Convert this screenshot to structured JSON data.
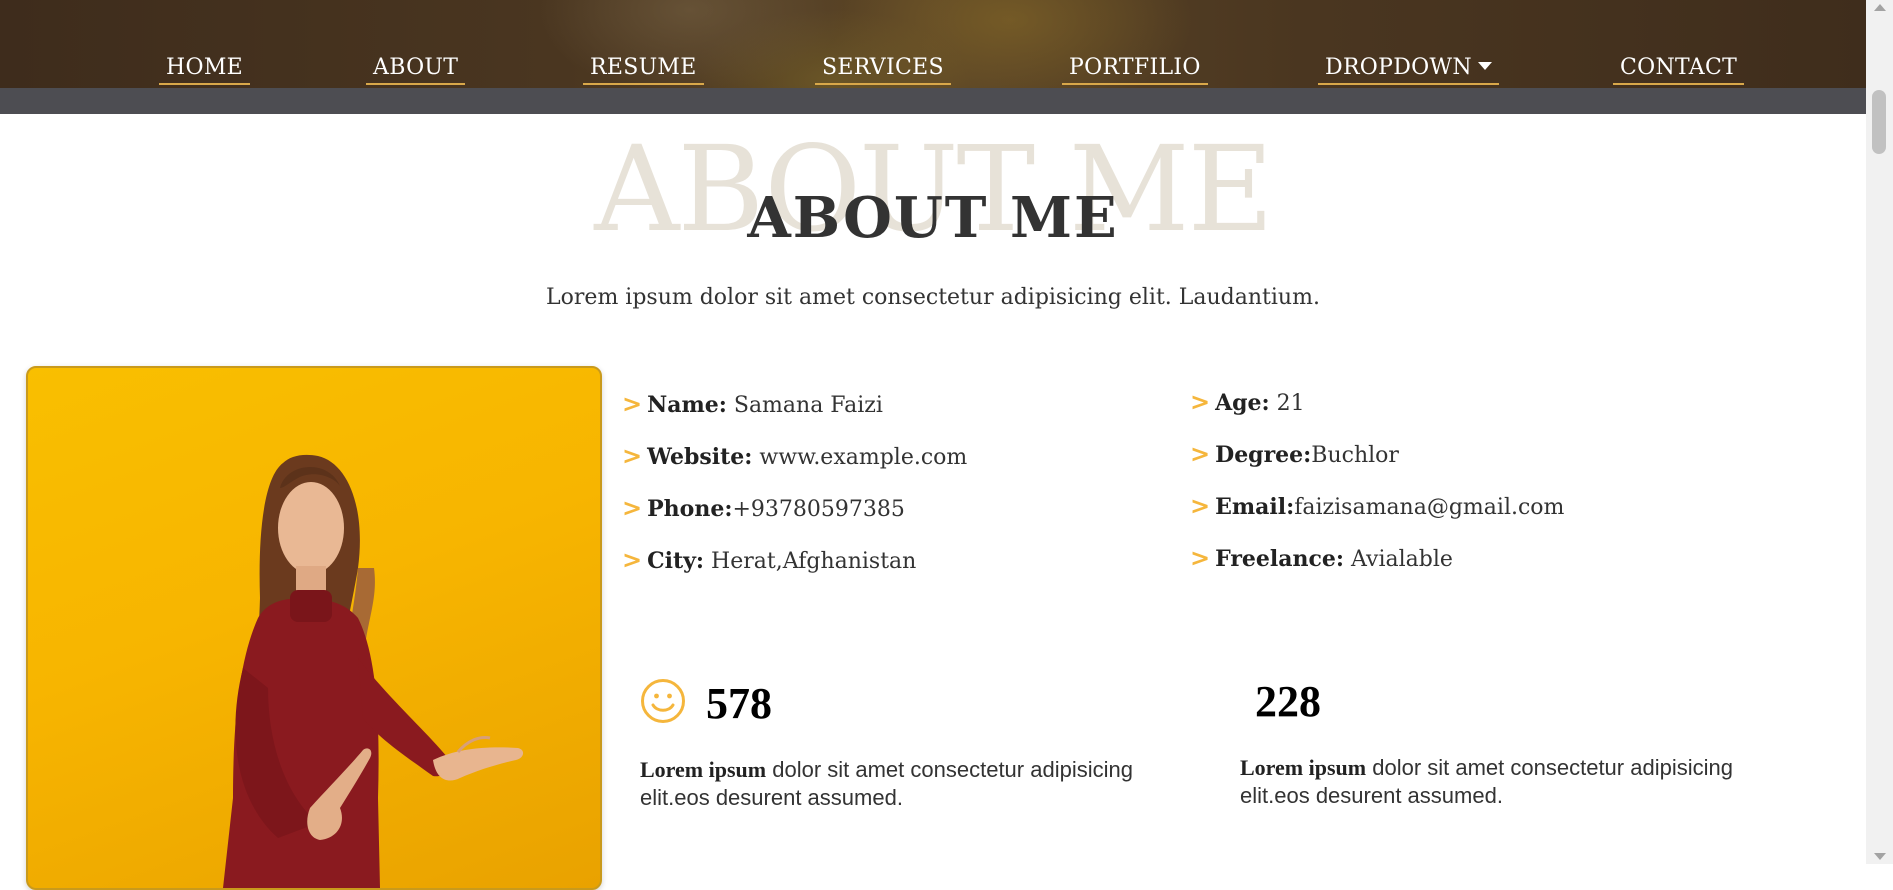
{
  "nav": {
    "items": [
      {
        "label": "HOME"
      },
      {
        "label": "ABOUT"
      },
      {
        "label": "RESUME"
      },
      {
        "label": "SERVICES"
      },
      {
        "label": "PORTFILIO"
      },
      {
        "label": "DROPDOWN"
      },
      {
        "label": "CONTACT"
      }
    ]
  },
  "about": {
    "title_bg": "ABOUT ME",
    "title": "ABOUT ME",
    "subtitle": "Lorem ipsum dolor sit amet consectetur adipisicing elit. Laudantium."
  },
  "info": {
    "left": [
      {
        "label": "Name:",
        "value": " Samana Faizi"
      },
      {
        "label": "Website:",
        "value": " www.example.com"
      },
      {
        "label": "Phone:",
        "value": "+93780597385"
      },
      {
        "label": "City:",
        "value": " Herat,Afghanistan"
      }
    ],
    "right": [
      {
        "label": "Age:",
        "value": " 21"
      },
      {
        "label": "Degree:",
        "value": "Buchlor"
      },
      {
        "label": "Email:",
        "value": "faizisamana@gmail.com"
      },
      {
        "label": "Freelance:",
        "value": " Avialable"
      }
    ]
  },
  "stats": [
    {
      "icon": "smiley-icon",
      "number": "578",
      "bold": "Lorem ipsum",
      "text": " dolor sit amet consectetur adipisicing elit.eos desurent assumed."
    },
    {
      "icon": "",
      "number": "228",
      "bold": "Lorem ipsum",
      "text": " dolor sit amet consectetur adipisicing elit.eos desurent assumed."
    }
  ],
  "colors": {
    "accent": "#f5b63c",
    "nav_underline": "#d9a84a",
    "photo_bg": "#f7b500",
    "title_ghost": "#e7e2d8",
    "header_strip": "#4d4d52"
  }
}
